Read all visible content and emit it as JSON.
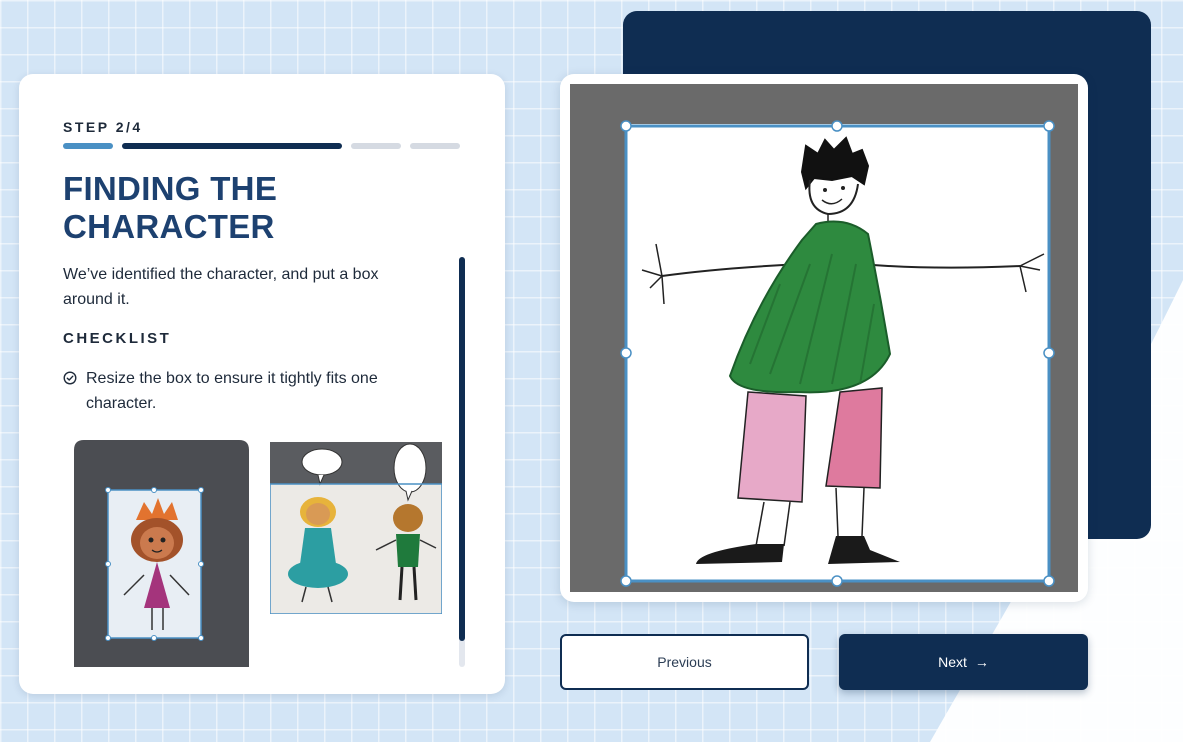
{
  "step": {
    "label": "STEP 2/4",
    "current": 2,
    "total": 4
  },
  "title": "FINDING THE CHARACTER",
  "description": "We’ve identified the character, and put a box around it.",
  "checklist": {
    "heading": "CHECKLIST",
    "items": [
      "Resize the box to ensure it tightly fits one character."
    ]
  },
  "buttons": {
    "previous": "Previous",
    "next": "Next",
    "next_icon": "→"
  },
  "colors": {
    "accent_dark": "#0f2d52",
    "accent_light": "#4a90c4",
    "title": "#1d4170",
    "progress_inactive": "#d5dae2",
    "background": "#d3e5f6"
  },
  "icons": {
    "check": "check-circle-icon",
    "arrow": "arrow-right-icon"
  }
}
